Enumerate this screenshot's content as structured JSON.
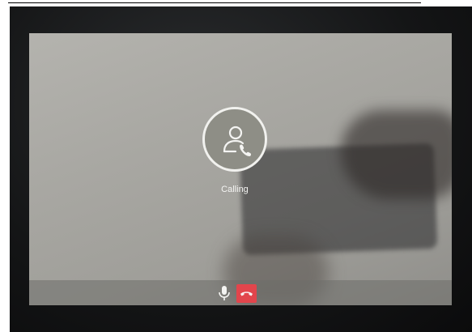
{
  "call": {
    "status_text": "Calling"
  },
  "icons": {
    "avatar": "person-phone-icon",
    "mic": "microphone-icon",
    "hangup": "phone-hangup-icon"
  },
  "colors": {
    "screen": "#a9a8a3",
    "hangup_button": "#e2454c",
    "foreground": "#f4f4f2"
  }
}
